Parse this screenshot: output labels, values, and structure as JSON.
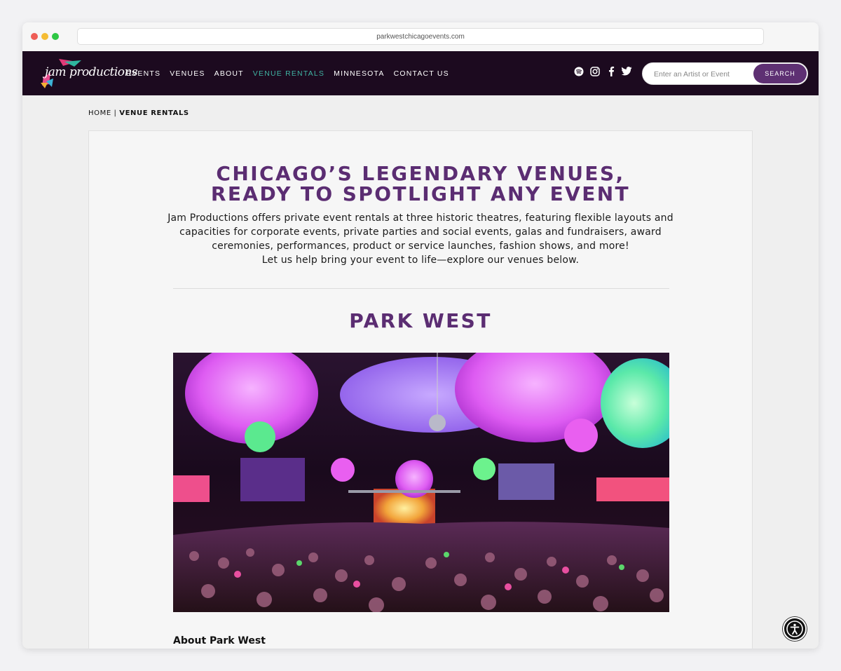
{
  "browser": {
    "url": "parkwestchicagoevents.com"
  },
  "logo": {
    "text": "jam productions"
  },
  "nav": {
    "items": [
      {
        "label": "EVENTS"
      },
      {
        "label": "VENUES"
      },
      {
        "label": "ABOUT"
      },
      {
        "label": "VENUE RENTALS",
        "active": true
      },
      {
        "label": "MINNESOTA"
      },
      {
        "label": "CONTACT US"
      }
    ],
    "social_icons": [
      "spotify-icon",
      "instagram-icon",
      "facebook-icon",
      "twitter-icon"
    ],
    "search": {
      "placeholder": "Enter an Artist or Event",
      "button": "SEARCH"
    }
  },
  "breadcrumb": {
    "home": "HOME",
    "separator": " | ",
    "current": "VENUE RENTALS"
  },
  "main": {
    "headline_line1": "CHICAGO’S LEGENDARY VENUES,",
    "headline_line2": "READY TO SPOTLIGHT ANY EVENT",
    "intro": "Jam Productions offers private event rentals at three historic theatres, featuring flexible layouts and capacities for corporate events, private parties and social events, galas and fundraisers, award ceremonies, performances, product or service launches, fashion shows, and more!",
    "intro_cta": "Let us help bring your event to life—explore our venues below.",
    "venue_title": "PARK WEST",
    "about_heading": "About Park West"
  },
  "colors": {
    "nav_bg": "#1c0a1f",
    "accent_purple": "#5b2d72",
    "active_link": "#3fb3a2"
  }
}
